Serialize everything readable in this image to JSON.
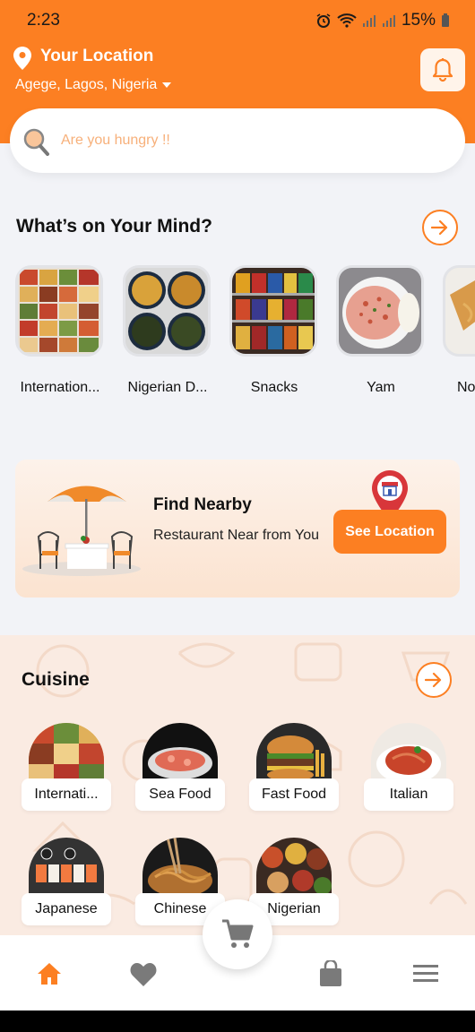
{
  "status": {
    "time": "2:23",
    "battery": "15%"
  },
  "header": {
    "location_title": "Your Location",
    "location_value": "Agege, Lagos, Nigeria",
    "accent_color": "#fc7f22"
  },
  "search": {
    "placeholder": "Are you hungry !!"
  },
  "mind": {
    "title": "What’s on Your Mind?",
    "items": [
      {
        "label": "Internation...",
        "icon": "international-food-grid"
      },
      {
        "label": "Nigerian D...",
        "icon": "nigerian-dishes-bowls"
      },
      {
        "label": "Snacks",
        "icon": "snacks-shelf"
      },
      {
        "label": "Yam",
        "icon": "yam-dish"
      },
      {
        "label": "No",
        "icon": "noodles-box"
      }
    ]
  },
  "nearby": {
    "title": "Find Nearby",
    "text": "Restaurant Near from You",
    "button": "See Location"
  },
  "cuisine": {
    "title": "Cuisine",
    "items": [
      {
        "label": "Internati..."
      },
      {
        "label": "Sea Food"
      },
      {
        "label": "Fast Food"
      },
      {
        "label": "Italian"
      },
      {
        "label": "Japanese"
      },
      {
        "label": "Chinese"
      },
      {
        "label": "Nigerian"
      }
    ]
  },
  "nav": {
    "items": [
      "home-icon",
      "heart-icon",
      "cart-icon",
      "bag-icon",
      "menu-icon"
    ]
  }
}
